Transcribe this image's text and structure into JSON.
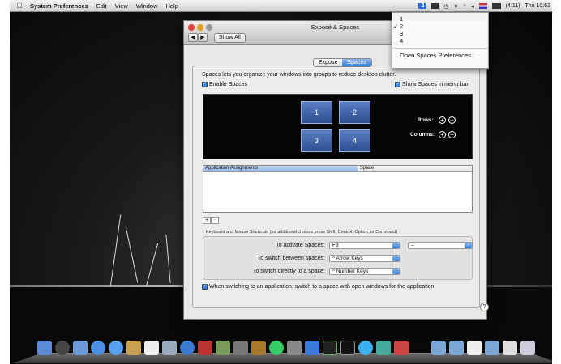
{
  "menubar": {
    "apple_icon": "apple-icon",
    "app_name": "System Preferences",
    "items": [
      "Edit",
      "View",
      "Window",
      "Help"
    ],
    "time": "Thu 10:53",
    "battery": "(4:11)",
    "spaces_indicator": "2"
  },
  "spaces_menu": {
    "items": [
      "1",
      "2",
      "3",
      "4"
    ],
    "checked": "2",
    "open_prefs": "Open Spaces Preferences..."
  },
  "window": {
    "title": "Exposé & Spaces",
    "show_all": "Show All",
    "tabs": [
      {
        "label": "Exposé"
      },
      {
        "label": "Spaces"
      }
    ],
    "active_tab": "Spaces"
  },
  "spaces": {
    "description": "Spaces lets you organize your windows into groups to reduce desktop clutter.",
    "enable_label": "Enable Spaces",
    "menu_bar_label": "Show Spaces in menu bar",
    "space_numbers": [
      "1",
      "2",
      "3",
      "4"
    ],
    "rows_label": "Rows:",
    "columns_label": "Columns:",
    "table_headers": [
      "Application Assignments",
      "Space"
    ],
    "shortcuts_label": "Keyboard and Mouse Shortcuts (for additional choices press Shift, Control, Option, or Command)",
    "activate_label": "To activate Spaces:",
    "activate_value": "F8",
    "activate_mouse": "–",
    "switch_between_label": "To switch between spaces:",
    "switch_between_value": "^ Arrow Keys",
    "switch_directly_label": "To switch directly to a space:",
    "switch_directly_value": "^ Number Keys",
    "switch_app_label": "When switching to an application, switch to a space with open windows for the application",
    "help": "?"
  },
  "colors": {
    "accent": "#3a7fd6",
    "space_tile": "#3b5fa8"
  }
}
